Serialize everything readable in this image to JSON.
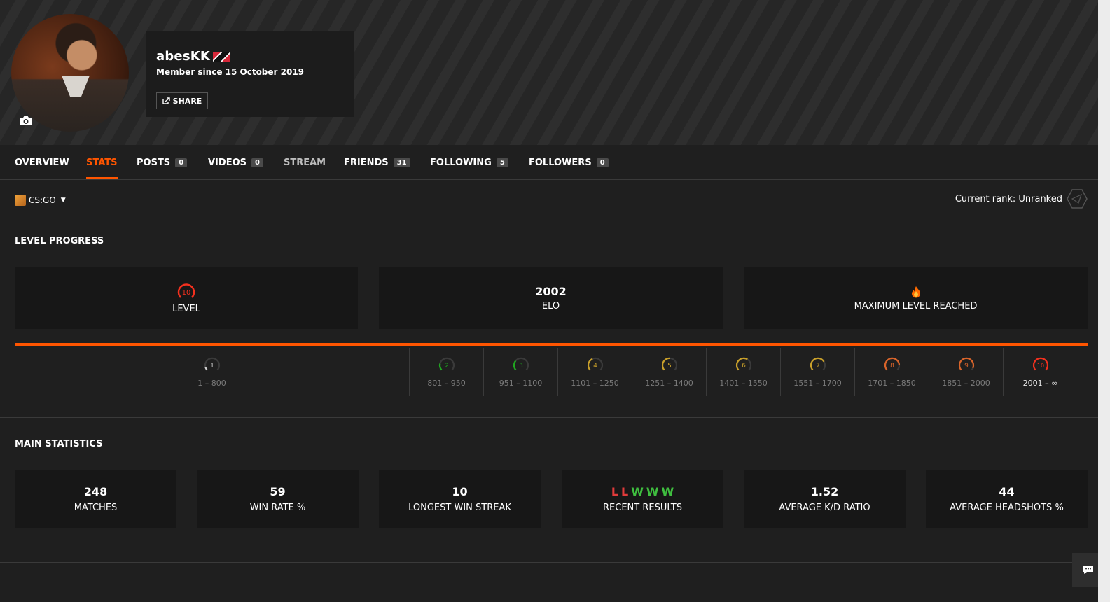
{
  "profile": {
    "nickname": "abesKK",
    "member_since": "Member since 15 October 2019",
    "share_label": "SHARE",
    "flag_icon": "trinidad-and-tobago-flag-icon",
    "avatar_icon": "profile-avatar",
    "camera_icon": "camera-icon"
  },
  "tabs": [
    {
      "label": "OVERVIEW",
      "count": null
    },
    {
      "label": "STATS",
      "count": null,
      "active": true
    },
    {
      "label": "POSTS",
      "count": "0"
    },
    {
      "label": "VIDEOS",
      "count": "0"
    },
    {
      "label": "STREAM",
      "count": null
    },
    {
      "label": "FRIENDS",
      "count": "31"
    },
    {
      "label": "FOLLOWING",
      "count": "5"
    },
    {
      "label": "FOLLOWERS",
      "count": "0"
    }
  ],
  "game_selector": {
    "label": "CS:GO",
    "icon": "csgo-game-icon"
  },
  "rank": {
    "label": "Current rank: Unranked",
    "icon": "unranked-rank-icon"
  },
  "level_progress": {
    "title": "LEVEL PROGRESS",
    "level_card": {
      "value": "10",
      "label": "LEVEL"
    },
    "elo_card": {
      "value": "2002",
      "label": "ELO"
    },
    "max_card": {
      "label": "MAXIMUM LEVEL REACHED",
      "icon": "fire-icon"
    },
    "progress_fraction": 1.0,
    "accent_color": "#ff5500",
    "levels": [
      {
        "level": "1",
        "range": "1 – 800",
        "color": "#cfcfcf"
      },
      {
        "level": "2",
        "range": "801 – 950",
        "color": "#1fa61f"
      },
      {
        "level": "3",
        "range": "951 – 1100",
        "color": "#1fa61f"
      },
      {
        "level": "4",
        "range": "1101 – 1250",
        "color": "#c9a02a"
      },
      {
        "level": "5",
        "range": "1251 – 1400",
        "color": "#c9a02a"
      },
      {
        "level": "6",
        "range": "1401 – 1550",
        "color": "#c9a02a"
      },
      {
        "level": "7",
        "range": "1551 – 1700",
        "color": "#c9a02a"
      },
      {
        "level": "8",
        "range": "1701 – 1850",
        "color": "#d9642a"
      },
      {
        "level": "9",
        "range": "1851 – 2000",
        "color": "#d9642a"
      },
      {
        "level": "10",
        "range": "2001 – ∞",
        "color": "#f2301e",
        "current": true
      }
    ]
  },
  "main_statistics": {
    "title": "MAIN STATISTICS",
    "matches": {
      "value": "248",
      "label": "MATCHES"
    },
    "win_rate": {
      "value": "59",
      "label": "WIN RATE %"
    },
    "longest_streak": {
      "value": "10",
      "label": "LONGEST WIN STREAK"
    },
    "recent_results": {
      "values": [
        "L",
        "L",
        "W",
        "W",
        "W"
      ],
      "label": "RECENT RESULTS"
    },
    "kd_ratio": {
      "value": "1.52",
      "label": "AVERAGE K/D RATIO"
    },
    "headshots": {
      "value": "44",
      "label": "AVERAGE HEADSHOTS %"
    }
  },
  "chat_button": {
    "icon": "chat-icon"
  }
}
